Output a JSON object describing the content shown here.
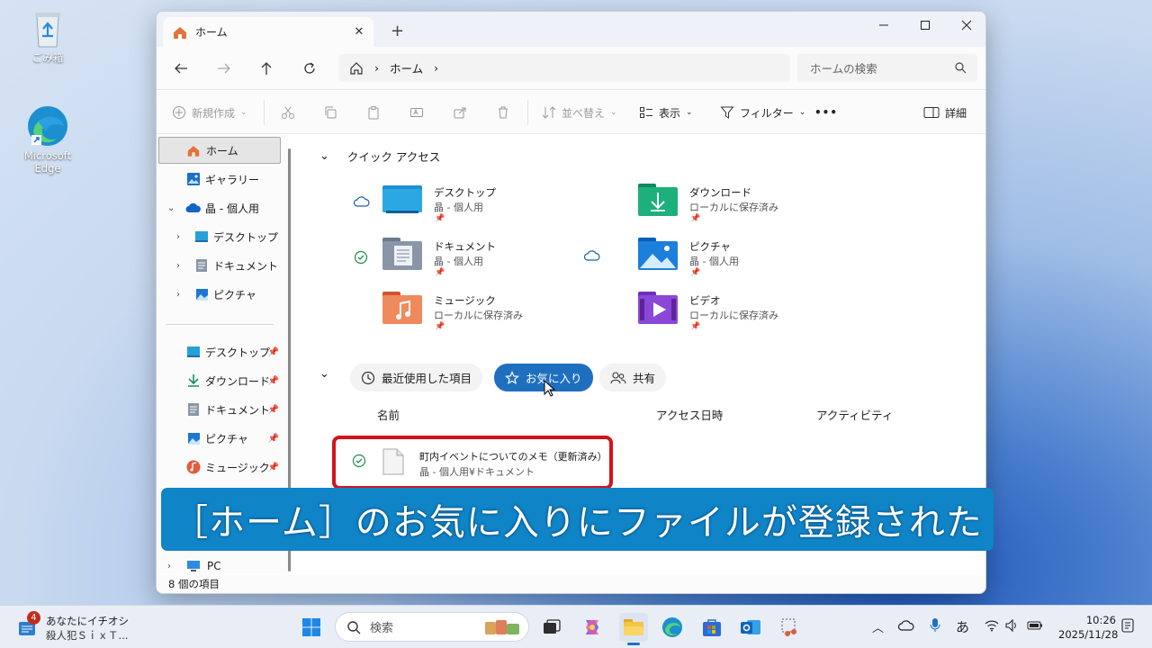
{
  "desktop": {
    "recycle_bin_label": "ごみ箱",
    "edge_label": "Microsoft Edge"
  },
  "window": {
    "tab_title": "ホーム",
    "new_tab_symbol": "+",
    "address": {
      "segment": "ホーム",
      "separator": "›"
    },
    "search_placeholder": "ホームの検索",
    "toolbar": {
      "new_label": "新規作成",
      "sort_label": "並べ替え",
      "view_label": "表示",
      "filter_label": "フィルター",
      "more_label": "•••",
      "details_label": "詳細"
    },
    "sidebar": {
      "items": [
        {
          "label": "ホーム"
        },
        {
          "label": "ギャラリー"
        },
        {
          "label": "晶 - 個人用"
        },
        {
          "label": "デスクトップ"
        },
        {
          "label": "ドキュメント"
        },
        {
          "label": "ピクチャ"
        }
      ],
      "pinned": [
        {
          "label": "デスクトップ"
        },
        {
          "label": "ダウンロード"
        },
        {
          "label": "ドキュメント"
        },
        {
          "label": "ピクチャ"
        },
        {
          "label": "ミュージック"
        }
      ],
      "pc_label": "PC"
    },
    "quick_access": {
      "title": "クイック アクセス",
      "folders": [
        {
          "name": "デスクトップ",
          "sub": "晶 - 個人用",
          "status": "cloud"
        },
        {
          "name": "ダウンロード",
          "sub": "ローカルに保存済み",
          "status": "none"
        },
        {
          "name": "ドキュメント",
          "sub": "晶 - 個人用",
          "status": "synced"
        },
        {
          "name": "ピクチャ",
          "sub": "晶 - 個人用",
          "status": "cloud"
        },
        {
          "name": "ミュージック",
          "sub": "ローカルに保存済み",
          "status": "none"
        },
        {
          "name": "ビデオ",
          "sub": "ローカルに保存済み",
          "status": "none"
        }
      ]
    },
    "tabs2": {
      "recent": "最近使用した項目",
      "favorites": "お気に入り",
      "shared": "共有"
    },
    "columns": {
      "name": "名前",
      "access": "アクセス日時",
      "activity": "アクティビティ"
    },
    "file": {
      "name": "町内イベントについてのメモ（更新済み）",
      "path": "晶 - 個人用¥ドキュメント"
    },
    "status_text": "8 個の項目"
  },
  "banner_text": "［ホーム］のお気に入りにファイルが登録された",
  "taskbar": {
    "news_badge": "4",
    "news_line1": "あなたにイチオシ",
    "news_line2": "殺人犯ＳｉｘＴ...",
    "search_label": "検索",
    "ime_label": "あ",
    "time": "10:26",
    "date": "2025/11/28"
  },
  "colors": {
    "accent": "#1f6fc1",
    "highlight": "#d4121b",
    "banner": "#0f84c7"
  }
}
